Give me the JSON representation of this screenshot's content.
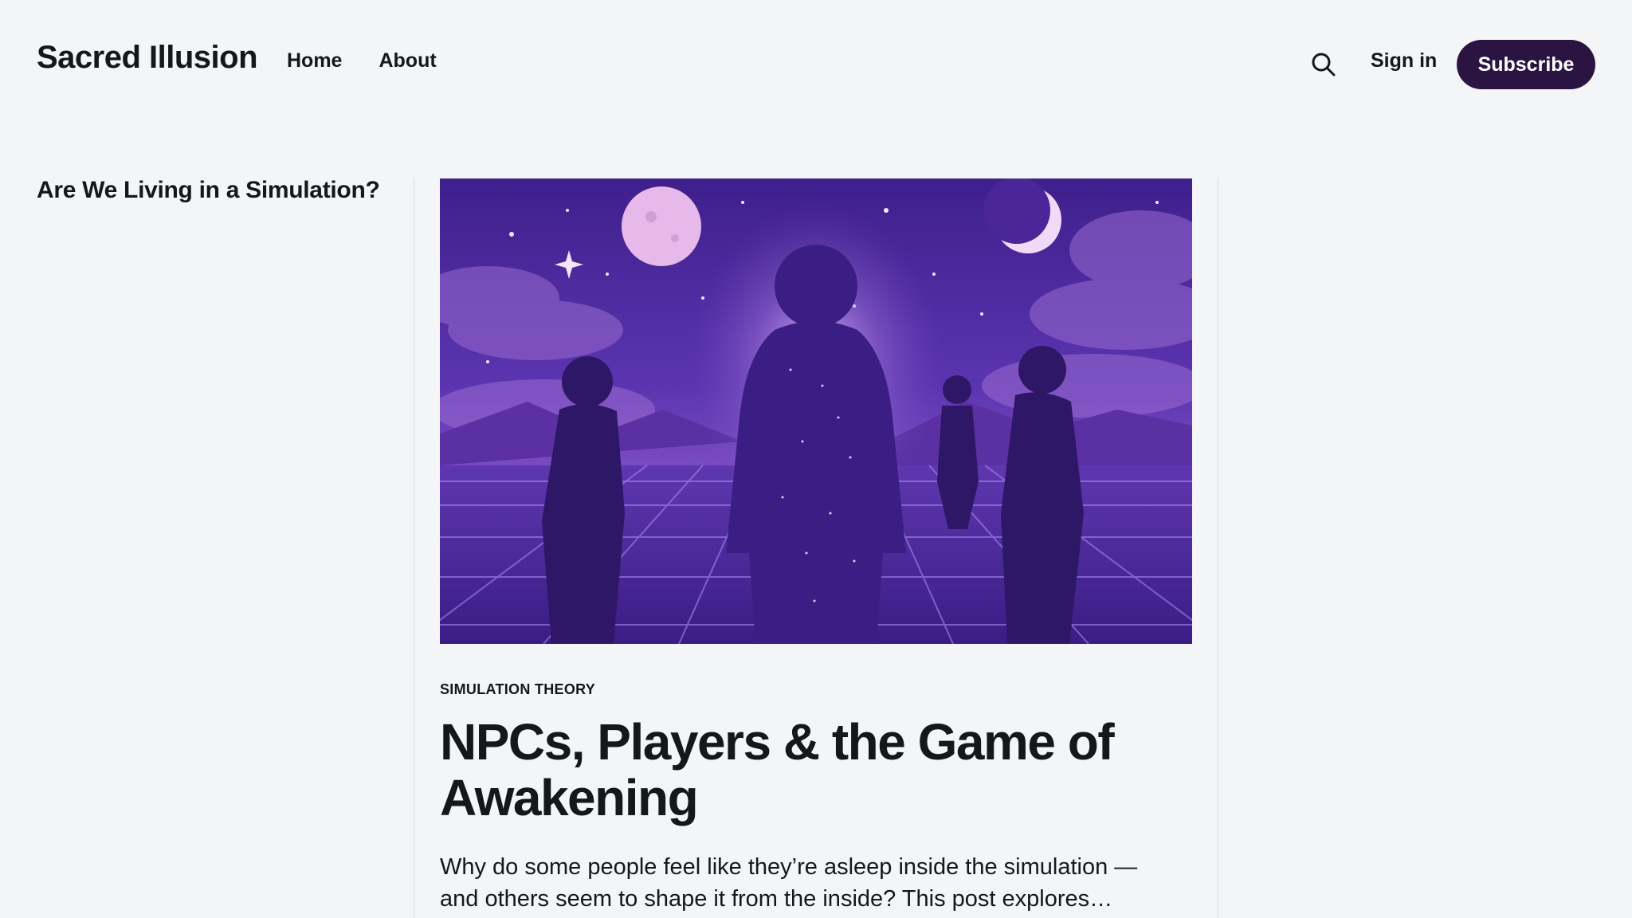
{
  "site": {
    "title": "Sacred Illusion"
  },
  "nav": {
    "items": [
      {
        "label": "Home"
      },
      {
        "label": "About"
      }
    ]
  },
  "header_actions": {
    "search_icon": "search-icon",
    "signin_label": "Sign in",
    "subscribe_label": "Subscribe"
  },
  "sidebar": {
    "title": "Are We Living in a Simulation?"
  },
  "post": {
    "tag": "SIMULATION THEORY",
    "title": "NPCs, Players & the Game of Awakening",
    "excerpt": "Why do some people feel like they’re asleep inside the simulation — and others seem to shape it from the inside? This post explores…"
  },
  "colors": {
    "background": "#f4f5f7",
    "text": "#15171a",
    "subscribe_bg": "#2b1441",
    "subscribe_text": "#ffffff",
    "hero_purple": "#5a31a8"
  }
}
